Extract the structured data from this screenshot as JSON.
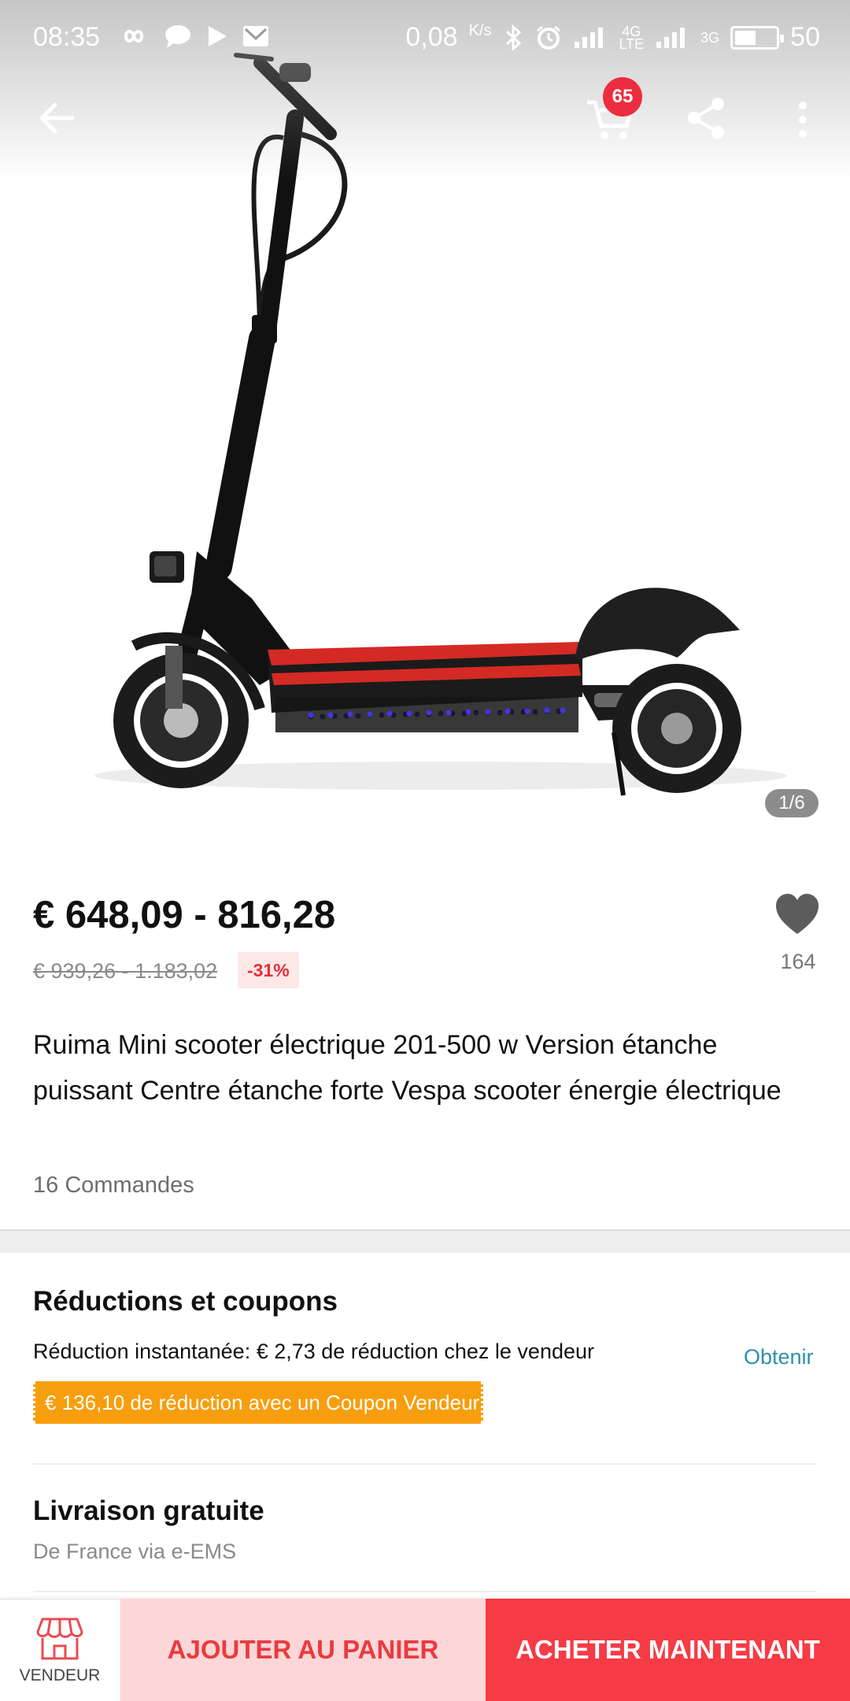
{
  "status_bar": {
    "time": "08:35",
    "speed": "0,08",
    "speed_unit": "K/s",
    "net_4g": "4G",
    "net_lte": "LTE",
    "net_3g": "3G",
    "battery": "50"
  },
  "nav": {
    "cart_count": "65"
  },
  "gallery": {
    "indicator": "1/6"
  },
  "product": {
    "price": "€ 648,09 - 816,28",
    "old_price": "€ 939,26 - 1.183,02",
    "discount": "-31%",
    "wishlist_count": "164",
    "title": "Ruima Mini scooter électrique 201-500 w Version étanche puissant Centre étanche forte Vespa scooter énergie électrique",
    "orders": "16 Commandes"
  },
  "coupons": {
    "title": "Réductions et coupons",
    "instant": "Réduction instantanée: € 2,73 de réduction chez le vendeur",
    "obtain": "Obtenir",
    "seller_coupon": "€ 136,10 de réduction avec un Coupon Vendeur"
  },
  "shipping": {
    "title": "Livraison gratuite",
    "from": "De France via e-EMS"
  },
  "actions": {
    "seller": "VENDEUR",
    "add_to_cart": "AJOUTER AU PANIER",
    "buy_now": "ACHETER MAINTENANT"
  },
  "colors": {
    "accent_red": "#f53b45",
    "cart_button_bg": "#fdd7d7",
    "coupon_orange": "#f79e0e",
    "link_blue": "#2d8fae",
    "discount_red": "#e62e3a"
  }
}
